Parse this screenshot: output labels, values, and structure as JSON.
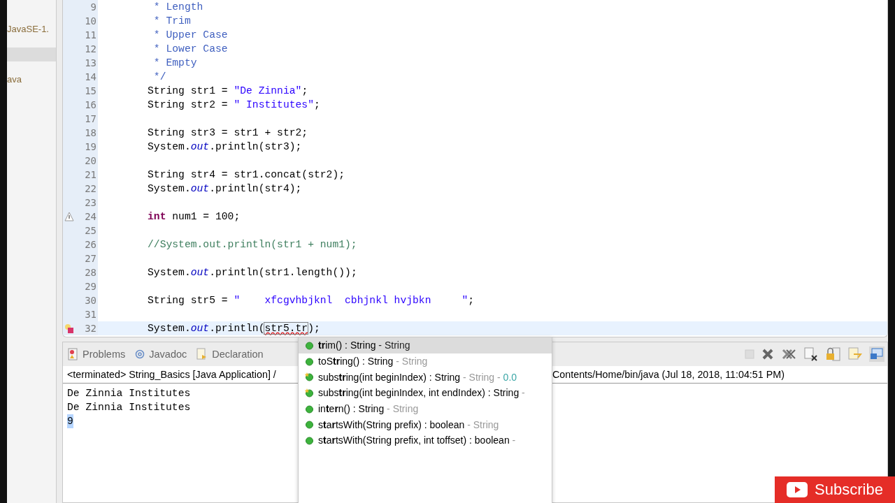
{
  "sidebar": {
    "items": [
      {
        "label": "JavaSE-1.",
        "selected": false
      },
      {
        "selected": true
      },
      {
        "label": "ava",
        "selected": false
      }
    ]
  },
  "editor": {
    "lines": [
      {
        "number": "9",
        "tokens": [
          {
            "text": " * Length",
            "kind": "doc"
          }
        ]
      },
      {
        "number": "10",
        "tokens": [
          {
            "text": " * Trim",
            "kind": "doc"
          }
        ]
      },
      {
        "number": "11",
        "tokens": [
          {
            "text": " * Upper Case",
            "kind": "doc"
          }
        ]
      },
      {
        "number": "12",
        "tokens": [
          {
            "text": " * Lower Case",
            "kind": "doc"
          }
        ]
      },
      {
        "number": "13",
        "tokens": [
          {
            "text": " * Empty",
            "kind": "doc"
          }
        ]
      },
      {
        "number": "14",
        "tokens": [
          {
            "text": " */",
            "kind": "doc"
          }
        ]
      },
      {
        "number": "15",
        "tokens": [
          {
            "text": "String str1 = ",
            "kind": "plain"
          },
          {
            "text": "\"De Zinnia\"",
            "kind": "string"
          },
          {
            "text": ";",
            "kind": "plain"
          }
        ]
      },
      {
        "number": "16",
        "tokens": [
          {
            "text": "String str2 = ",
            "kind": "plain"
          },
          {
            "text": "\" Institutes\"",
            "kind": "string"
          },
          {
            "text": ";",
            "kind": "plain"
          }
        ]
      },
      {
        "number": "17"
      },
      {
        "number": "18",
        "tokens": [
          {
            "text": "String str3 = str1 + str2;",
            "kind": "plain"
          }
        ]
      },
      {
        "number": "19",
        "tokens": [
          {
            "text": "System.",
            "kind": "plain"
          },
          {
            "text": "out",
            "kind": "field"
          },
          {
            "text": ".println(str3);",
            "kind": "plain"
          }
        ]
      },
      {
        "number": "20"
      },
      {
        "number": "21",
        "tokens": [
          {
            "text": "String str4 = str1.concat(str2);",
            "kind": "plain"
          }
        ]
      },
      {
        "number": "22",
        "tokens": [
          {
            "text": "System.",
            "kind": "plain"
          },
          {
            "text": "out",
            "kind": "field"
          },
          {
            "text": ".println(str4);",
            "kind": "plain"
          }
        ]
      },
      {
        "number": "23"
      },
      {
        "number": "24",
        "warning": true,
        "tokens": [
          {
            "text": "int",
            "kind": "keyword"
          },
          {
            "text": " num1 = 100;",
            "kind": "plain"
          }
        ]
      },
      {
        "number": "25"
      },
      {
        "number": "26",
        "tokens": [
          {
            "text": "//System.out.println(str1 + num1);",
            "kind": "comment"
          }
        ]
      },
      {
        "number": "27"
      },
      {
        "number": "28",
        "tokens": [
          {
            "text": "System.",
            "kind": "plain"
          },
          {
            "text": "out",
            "kind": "field"
          },
          {
            "text": ".println(str1.length());",
            "kind": "plain"
          }
        ]
      },
      {
        "number": "29"
      },
      {
        "number": "30",
        "tokens": [
          {
            "text": "String str5 = ",
            "kind": "plain"
          },
          {
            "text": "\"    xfcgvhbjknl  cbhjnkl hvjbkn     \"",
            "kind": "string"
          },
          {
            "text": ";",
            "kind": "plain"
          }
        ]
      },
      {
        "number": "31"
      },
      {
        "number": "32",
        "error": true,
        "current": true,
        "tokens": [
          {
            "text": "System.",
            "kind": "plain"
          },
          {
            "text": "out",
            "kind": "field"
          },
          {
            "text": ".println(",
            "kind": "plain"
          },
          {
            "text": "str5.tr",
            "kind": "error"
          },
          {
            "text": ");",
            "kind": "plain"
          }
        ]
      }
    ]
  },
  "console": {
    "tabs": [
      {
        "label": "Problems",
        "kind": "problems",
        "selected": false
      },
      {
        "label": "Javadoc",
        "kind": "javadoc",
        "selected": false
      },
      {
        "label": "Declaration",
        "kind": "declaration",
        "selected": false
      }
    ],
    "header_left": "<terminated> String_Basics [Java Application] /",
    "header_right": "Contents/Home/bin/java (Jul 18, 2018, 11:04:51 PM)",
    "output": [
      "De Zinnia Institutes",
      "De Zinnia Institutes",
      "9"
    ]
  },
  "completion": {
    "items": [
      {
        "label": "**tr**im() : String",
        "detail": "- String",
        "selected": true,
        "kind": "method"
      },
      {
        "label": "toS**tr**ing() : String",
        "detail": "- String",
        "selected": false,
        "kind": "method"
      },
      {
        "label": "subs**tr**ing(int beginIndex) : String",
        "detail": "- String - ",
        "extra": "0.0",
        "selected": false,
        "kind": "starred"
      },
      {
        "label": "subs**tr**ing(int beginIndex, int endIndex) : String",
        "detail": "-",
        "selected": false,
        "kind": "starred"
      },
      {
        "label": "in**t**e**r**n() : String",
        "detail": "- String",
        "selected": false,
        "kind": "method"
      },
      {
        "label": "s**t**a**r**tsWith(String prefix) : boolean",
        "detail": "- String",
        "selected": false,
        "kind": "method"
      },
      {
        "label": "s**t**a**r**tsWith(String prefix, int toffset) : boolean",
        "detail": "-",
        "selected": false,
        "kind": "method"
      }
    ]
  },
  "overlay": {
    "subscribe": "Subscribe"
  }
}
